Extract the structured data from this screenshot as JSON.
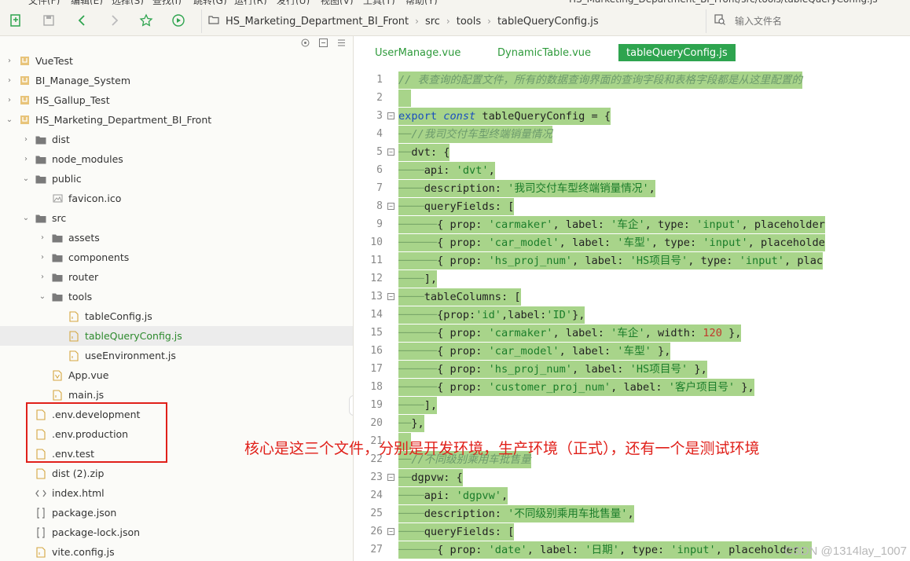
{
  "menubar": {
    "items": [
      "文件(F)",
      "编辑(E)",
      "选择(S)",
      "查找(I)",
      "跳转(G)",
      "运行(R)",
      "发行(U)",
      "视图(V)",
      "工具(T)",
      "帮助(Y)"
    ],
    "title": "HS_Marketing_Department_BI_Front/src/tools/tableQueryConfig.js - HBuilder X"
  },
  "toolbar": {
    "breadcrumb": [
      "HS_Marketing_Department_BI_Front",
      "src",
      "tools",
      "tableQueryConfig.js"
    ],
    "search_placeholder": "输入文件名"
  },
  "sidebar": {
    "items": [
      {
        "label": "VueTest",
        "depth": 0,
        "arrow": "›",
        "icon": "project"
      },
      {
        "label": "BI_Manage_System",
        "depth": 0,
        "arrow": "›",
        "icon": "project"
      },
      {
        "label": "HS_Gallup_Test",
        "depth": 0,
        "arrow": "›",
        "icon": "project"
      },
      {
        "label": "HS_Marketing_Department_BI_Front",
        "depth": 0,
        "arrow": "⌄",
        "icon": "project"
      },
      {
        "label": "dist",
        "depth": 1,
        "arrow": "›",
        "icon": "folder"
      },
      {
        "label": "node_modules",
        "depth": 1,
        "arrow": "›",
        "icon": "folder"
      },
      {
        "label": "public",
        "depth": 1,
        "arrow": "⌄",
        "icon": "folder"
      },
      {
        "label": "favicon.ico",
        "depth": 2,
        "arrow": "",
        "icon": "image"
      },
      {
        "label": "src",
        "depth": 1,
        "arrow": "⌄",
        "icon": "folder"
      },
      {
        "label": "assets",
        "depth": 2,
        "arrow": "›",
        "icon": "folder"
      },
      {
        "label": "components",
        "depth": 2,
        "arrow": "›",
        "icon": "folder"
      },
      {
        "label": "router",
        "depth": 2,
        "arrow": "›",
        "icon": "folder"
      },
      {
        "label": "tools",
        "depth": 2,
        "arrow": "⌄",
        "icon": "folder"
      },
      {
        "label": "tableConfig.js",
        "depth": 3,
        "arrow": "",
        "icon": "js"
      },
      {
        "label": "tableQueryConfig.js",
        "depth": 3,
        "arrow": "",
        "icon": "js",
        "selected": true
      },
      {
        "label": "useEnvironment.js",
        "depth": 3,
        "arrow": "",
        "icon": "js"
      },
      {
        "label": "App.vue",
        "depth": 2,
        "arrow": "",
        "icon": "vue"
      },
      {
        "label": "main.js",
        "depth": 2,
        "arrow": "",
        "icon": "js"
      },
      {
        "label": ".env.development",
        "depth": 1,
        "arrow": "",
        "icon": "file"
      },
      {
        "label": ".env.production",
        "depth": 1,
        "arrow": "",
        "icon": "file"
      },
      {
        "label": ".env.test",
        "depth": 1,
        "arrow": "",
        "icon": "file"
      },
      {
        "label": "dist (2).zip",
        "depth": 1,
        "arrow": "",
        "icon": "file"
      },
      {
        "label": "index.html",
        "depth": 1,
        "arrow": "",
        "icon": "html"
      },
      {
        "label": "package.json",
        "depth": 1,
        "arrow": "",
        "icon": "json"
      },
      {
        "label": "package-lock.json",
        "depth": 1,
        "arrow": "",
        "icon": "json"
      },
      {
        "label": "vite.config.js",
        "depth": 1,
        "arrow": "",
        "icon": "js"
      }
    ]
  },
  "tabs": [
    {
      "label": "UserManage.vue",
      "active": false
    },
    {
      "label": "DynamicTable.vue",
      "active": false
    },
    {
      "label": "tableQueryConfig.js",
      "active": true
    }
  ],
  "editor": {
    "lines": [
      {
        "n": "1",
        "fold": false
      },
      {
        "n": "2",
        "fold": false
      },
      {
        "n": "3",
        "fold": true
      },
      {
        "n": "4",
        "fold": false
      },
      {
        "n": "5",
        "fold": true
      },
      {
        "n": "6",
        "fold": false
      },
      {
        "n": "7",
        "fold": false
      },
      {
        "n": "8",
        "fold": true
      },
      {
        "n": "9",
        "fold": false
      },
      {
        "n": "10",
        "fold": false
      },
      {
        "n": "11",
        "fold": false
      },
      {
        "n": "12",
        "fold": false
      },
      {
        "n": "13",
        "fold": true
      },
      {
        "n": "14",
        "fold": false
      },
      {
        "n": "15",
        "fold": false
      },
      {
        "n": "16",
        "fold": false
      },
      {
        "n": "17",
        "fold": false
      },
      {
        "n": "18",
        "fold": false
      },
      {
        "n": "19",
        "fold": false
      },
      {
        "n": "20",
        "fold": false
      },
      {
        "n": "21",
        "fold": false
      },
      {
        "n": "22",
        "fold": false
      },
      {
        "n": "23",
        "fold": true
      },
      {
        "n": "24",
        "fold": false
      },
      {
        "n": "25",
        "fold": false
      },
      {
        "n": "26",
        "fold": true
      },
      {
        "n": "27",
        "fold": false
      }
    ],
    "code": [
      [
        {
          "t": "// 表查询的配置文件，所有的数据查询界面的查询字段和表格字段都是从这里配置的",
          "c": "c"
        }
      ],
      [],
      [
        {
          "t": "export",
          "c": "k"
        },
        {
          "t": " "
        },
        {
          "t": "const",
          "c": "ki"
        },
        {
          "t": " tableQueryConfig "
        },
        {
          "t": "="
        },
        {
          "t": " {"
        }
      ],
      [
        {
          "t": "──",
          "c": "ws"
        },
        {
          "t": "//我司交付车型终端销量情况",
          "c": "c"
        }
      ],
      [
        {
          "t": "──",
          "c": "ws"
        },
        {
          "t": "dvt: {"
        }
      ],
      [
        {
          "t": "────",
          "c": "ws"
        },
        {
          "t": "api: "
        },
        {
          "t": "'dvt'",
          "c": "s"
        },
        {
          "t": ","
        }
      ],
      [
        {
          "t": "────",
          "c": "ws"
        },
        {
          "t": "description: "
        },
        {
          "t": "'我司交付车型终端销量情况'",
          "c": "s"
        },
        {
          "t": ","
        }
      ],
      [
        {
          "t": "────",
          "c": "ws"
        },
        {
          "t": "queryFields: ["
        }
      ],
      [
        {
          "t": "──────",
          "c": "ws"
        },
        {
          "t": "{ prop: "
        },
        {
          "t": "'carmaker'",
          "c": "s"
        },
        {
          "t": ", label: "
        },
        {
          "t": "'车企'",
          "c": "s"
        },
        {
          "t": ", type: "
        },
        {
          "t": "'input'",
          "c": "s"
        },
        {
          "t": ", placeholder"
        }
      ],
      [
        {
          "t": "──────",
          "c": "ws"
        },
        {
          "t": "{ prop: "
        },
        {
          "t": "'car_model'",
          "c": "s"
        },
        {
          "t": ", label: "
        },
        {
          "t": "'车型'",
          "c": "s"
        },
        {
          "t": ", type: "
        },
        {
          "t": "'input'",
          "c": "s"
        },
        {
          "t": ", placeholde"
        }
      ],
      [
        {
          "t": "──────",
          "c": "ws"
        },
        {
          "t": "{ prop: "
        },
        {
          "t": "'hs_proj_num'",
          "c": "s"
        },
        {
          "t": ", label: "
        },
        {
          "t": "'HS项目号'",
          "c": "s"
        },
        {
          "t": ", type: "
        },
        {
          "t": "'input'",
          "c": "s"
        },
        {
          "t": ", plac"
        }
      ],
      [
        {
          "t": "────",
          "c": "ws"
        },
        {
          "t": "],"
        }
      ],
      [
        {
          "t": "────",
          "c": "ws"
        },
        {
          "t": "tableColumns: ["
        }
      ],
      [
        {
          "t": "──────",
          "c": "ws"
        },
        {
          "t": "{prop:"
        },
        {
          "t": "'id'",
          "c": "s"
        },
        {
          "t": ",label:"
        },
        {
          "t": "'ID'",
          "c": "s"
        },
        {
          "t": "},"
        }
      ],
      [
        {
          "t": "──────",
          "c": "ws"
        },
        {
          "t": "{ prop: "
        },
        {
          "t": "'carmaker'",
          "c": "s"
        },
        {
          "t": ", label: "
        },
        {
          "t": "'车企'",
          "c": "s"
        },
        {
          "t": ", width: "
        },
        {
          "t": "120",
          "c": "n"
        },
        {
          "t": " },"
        }
      ],
      [
        {
          "t": "──────",
          "c": "ws"
        },
        {
          "t": "{ prop: "
        },
        {
          "t": "'car_model'",
          "c": "s"
        },
        {
          "t": ", label: "
        },
        {
          "t": "'车型'",
          "c": "s"
        },
        {
          "t": " },"
        }
      ],
      [
        {
          "t": "──────",
          "c": "ws"
        },
        {
          "t": "{ prop: "
        },
        {
          "t": "'hs_proj_num'",
          "c": "s"
        },
        {
          "t": ", label: "
        },
        {
          "t": "'HS项目号'",
          "c": "s"
        },
        {
          "t": " },"
        }
      ],
      [
        {
          "t": "──────",
          "c": "ws"
        },
        {
          "t": "{ prop: "
        },
        {
          "t": "'customer_proj_num'",
          "c": "s"
        },
        {
          "t": ", label: "
        },
        {
          "t": "'客户项目号'",
          "c": "s"
        },
        {
          "t": " },"
        }
      ],
      [
        {
          "t": "────",
          "c": "ws"
        },
        {
          "t": "],"
        }
      ],
      [
        {
          "t": "──",
          "c": "ws"
        },
        {
          "t": "},"
        }
      ],
      [],
      [
        {
          "t": "──",
          "c": "ws"
        },
        {
          "t": "//不同级别乘用车批售量",
          "c": "c"
        }
      ],
      [
        {
          "t": "──",
          "c": "ws"
        },
        {
          "t": "dgpvw: {"
        }
      ],
      [
        {
          "t": "────",
          "c": "ws"
        },
        {
          "t": "api: "
        },
        {
          "t": "'dgpvw'",
          "c": "s"
        },
        {
          "t": ","
        }
      ],
      [
        {
          "t": "────",
          "c": "ws"
        },
        {
          "t": "description: "
        },
        {
          "t": "'不同级别乘用车批售量'",
          "c": "s"
        },
        {
          "t": ","
        }
      ],
      [
        {
          "t": "────",
          "c": "ws"
        },
        {
          "t": "queryFields: ["
        }
      ],
      [
        {
          "t": "──────",
          "c": "ws"
        },
        {
          "t": "{ prop: "
        },
        {
          "t": "'date'",
          "c": "s"
        },
        {
          "t": ", label: "
        },
        {
          "t": "'日期'",
          "c": "s"
        },
        {
          "t": ", type: "
        },
        {
          "t": "'input'",
          "c": "s"
        },
        {
          "t": ", placeholder: "
        }
      ]
    ]
  },
  "annotation": "核心是这三个文件，分别是开发环境，生产环境（正式），还有一个是测试环境",
  "watermark": "CSDN @1314lay_1007",
  "colors": {
    "accent": "#2ea44f",
    "highlight": "#a8d48a",
    "annotation": "#e0201a"
  }
}
